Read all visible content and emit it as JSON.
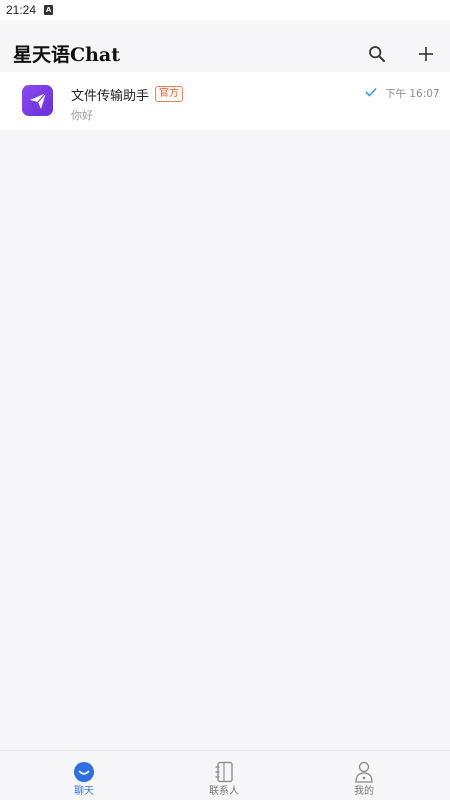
{
  "status_bar": {
    "time": "21:24",
    "indicator": "A"
  },
  "header": {
    "title": "星天语Chat"
  },
  "chats": [
    {
      "name": "文件传输助手",
      "badge": "官方",
      "preview": "你好",
      "time": "下午 16:07",
      "read": true
    }
  ],
  "bottom_nav": {
    "items": [
      {
        "label": "聊天",
        "active": true
      },
      {
        "label": "联系人",
        "active": false
      },
      {
        "label": "我的",
        "active": false
      }
    ]
  },
  "colors": {
    "accent": "#3b78e7",
    "badge": "#d9693a",
    "avatar": "#7b3be6"
  }
}
